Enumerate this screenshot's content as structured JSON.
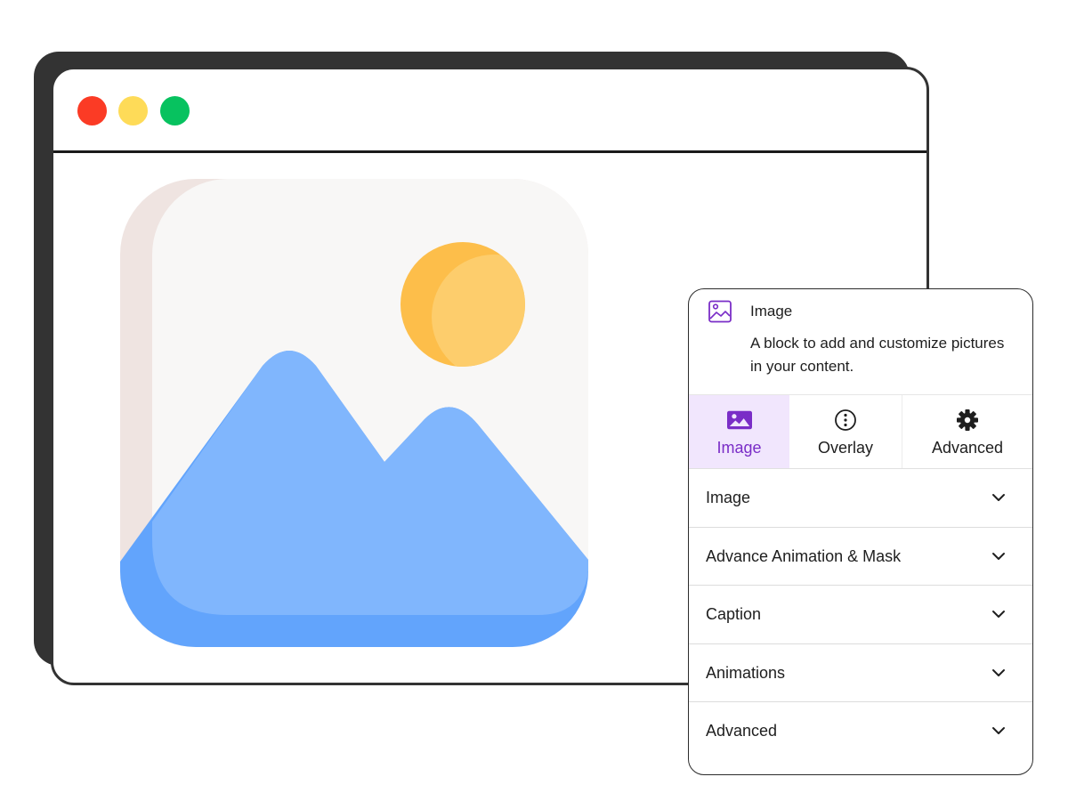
{
  "window": {
    "controls": [
      {
        "name": "close",
        "color": "#fb3b25"
      },
      {
        "name": "minimize",
        "color": "#fedb58"
      },
      {
        "name": "maximize",
        "color": "#07c25f"
      }
    ]
  },
  "illustration": {
    "icon": "image-placeholder-icon",
    "colors": {
      "card": "#f8f7f6",
      "card_side": "#efe4e1",
      "sun": "#fdcd6c",
      "sun_shade": "#fdbe4a",
      "mountain": "#80b6fd",
      "mountain_shade": "#62a4fc"
    }
  },
  "panel": {
    "block": {
      "icon": "image-block-icon",
      "title": "Image",
      "description": "A block to add and customize pictures in your content."
    },
    "accent": "#7a2dc7",
    "tabs": [
      {
        "label": "Image",
        "icon": "image-icon",
        "active": true
      },
      {
        "label": "Overlay",
        "icon": "ellipsis-circle-icon",
        "active": false
      },
      {
        "label": "Advanced",
        "icon": "gear-icon",
        "active": false
      }
    ],
    "sections": [
      {
        "label": "Image"
      },
      {
        "label": "Advance Animation & Mask"
      },
      {
        "label": "Caption"
      },
      {
        "label": "Animations"
      },
      {
        "label": "Advanced"
      }
    ]
  }
}
